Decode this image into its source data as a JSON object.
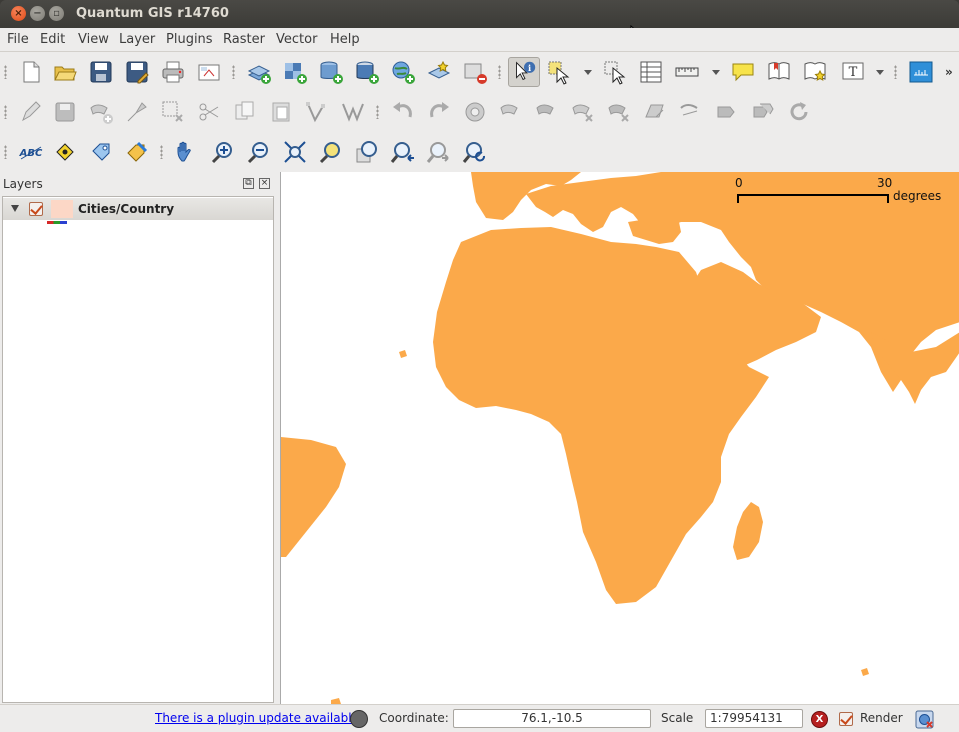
{
  "window": {
    "title": "Quantum GIS r14760"
  },
  "menu": [
    "File",
    "Edit",
    "View",
    "Layer",
    "Plugins",
    "Raster",
    "Vector",
    "Help"
  ],
  "layers_panel": {
    "title": "Layers",
    "layers": [
      {
        "name": "Cities/Country",
        "visible": true,
        "fill_color": "#fcd7c6"
      }
    ]
  },
  "map": {
    "land_color": "#fba94a",
    "background": "#ffffff",
    "scalebar": {
      "start": "0",
      "end": "30",
      "unit": "degrees"
    }
  },
  "statusbar": {
    "plugin_update": "There is a plugin update available",
    "coordinate_label": "Coordinate:",
    "coordinate_value": "76.1,-10.5",
    "scale_label": "Scale",
    "scale_value": "1:79954131",
    "render_label": "Render",
    "render_checked": true
  },
  "toolbar_icons": {
    "row1": [
      "new-project-icon",
      "open-project-icon",
      "save-project-icon",
      "save-as-icon",
      "print-composer-icon",
      "composer-manager-icon",
      "add-vector-layer-icon",
      "add-raster-layer-icon",
      "add-postgis-layer-icon",
      "add-spatialite-layer-icon",
      "add-wms-layer-icon",
      "new-shapefile-icon",
      "remove-layer-icon",
      "identify-icon",
      "select-features-icon",
      "deselect-icon",
      "open-attribute-table-icon",
      "measure-line-icon",
      "map-tips-icon",
      "new-bookmark-icon",
      "show-bookmarks-icon",
      "text-annotation-icon",
      "python-console-icon"
    ],
    "row2": [
      "toggle-editing-icon",
      "save-edits-icon",
      "add-feature-icon",
      "move-feature-icon",
      "delete-selected-icon",
      "cut-features-icon",
      "copy-features-icon",
      "paste-features-icon",
      "node-tool-icon",
      "simplify-icon",
      "undo-icon",
      "redo-icon",
      "add-ring-icon",
      "add-part-icon",
      "fill-ring-icon",
      "delete-ring-icon",
      "delete-part-icon",
      "reshape-icon",
      "offset-curve-icon",
      "split-features-icon",
      "merge-selected-icon",
      "merge-attributes-icon",
      "rotate-symbol-icon"
    ],
    "row3": [
      "label-icon",
      "pin-label-icon",
      "rotate-label-icon",
      "change-label-icon",
      "pan-icon",
      "zoom-in-icon",
      "zoom-out-icon",
      "zoom-full-icon",
      "zoom-to-selection-icon",
      "zoom-to-layer-icon",
      "zoom-last-icon",
      "zoom-next-icon",
      "refresh-icon"
    ]
  }
}
